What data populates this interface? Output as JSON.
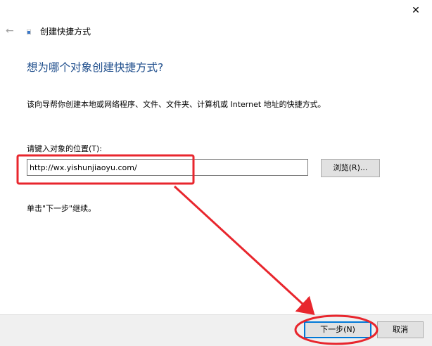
{
  "window": {
    "title": "创建快捷方式",
    "close_glyph": "✕",
    "back_glyph": "←"
  },
  "page": {
    "heading": "想为哪个对象创建快捷方式?",
    "description": "该向导帮你创建本地或网络程序、文件、文件夹、计算机或 Internet 地址的快捷方式。",
    "location_label": "请键入对象的位置(T):",
    "location_value": "http://wx.yishunjiaoyu.com/",
    "browse_label": "浏览(R)...",
    "instruction": "单击\"下一步\"继续。"
  },
  "footer": {
    "next_label": "下一步(N)",
    "cancel_label": "取消"
  },
  "colors": {
    "heading": "#1f4e8c",
    "annotation": "#e8262d",
    "default_button_border": "#0078d7",
    "footer_bg": "#f0f0f0"
  }
}
